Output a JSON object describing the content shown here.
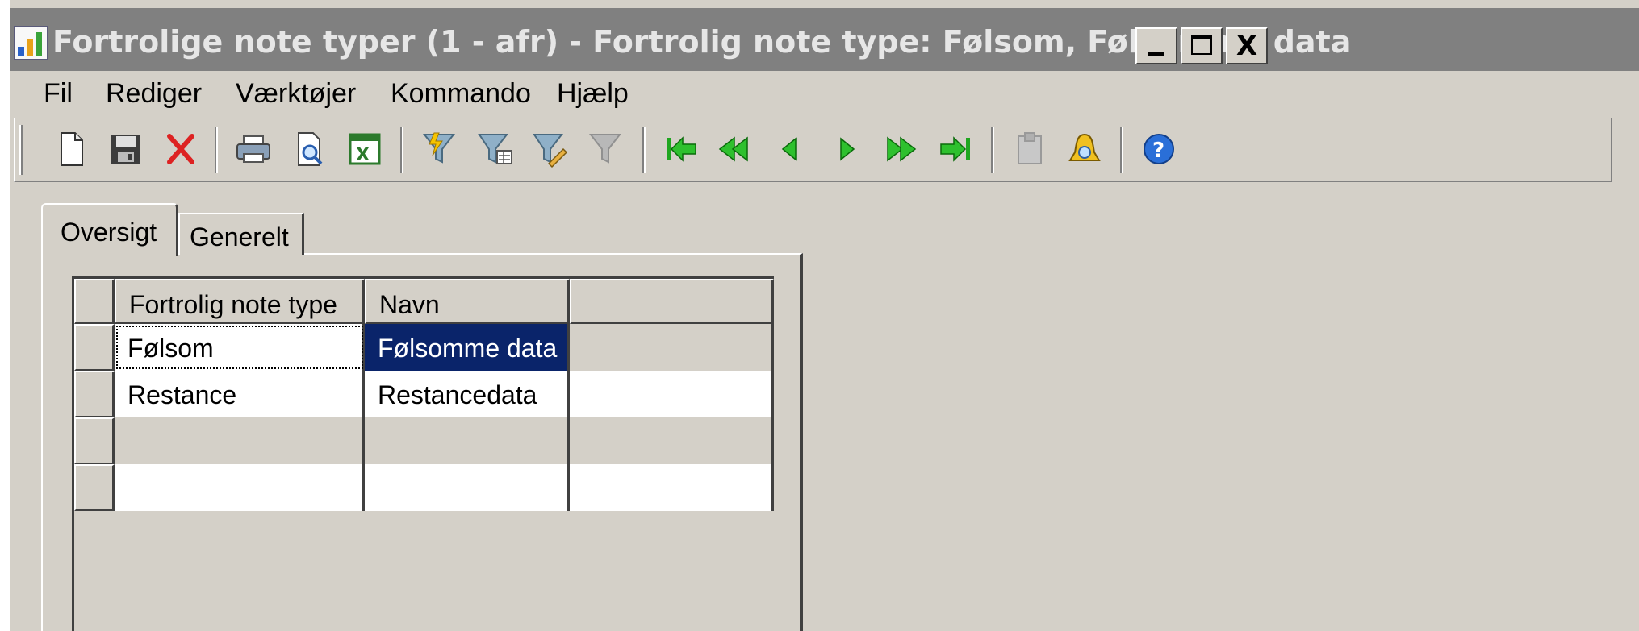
{
  "window": {
    "title": "Fortrolige note typer (1 - afr) - Fortrolig note type: Følsom, Følsomme data",
    "app_icon": "dynamics-ax-chart-icon",
    "controls": {
      "minimize": "",
      "maximize": "",
      "close": "X"
    }
  },
  "menu": [
    {
      "label": "Fil"
    },
    {
      "label": "Rediger"
    },
    {
      "label": "Værktøjer"
    },
    {
      "label": "Kommando"
    },
    {
      "label": "Hjælp"
    }
  ],
  "toolbar": {
    "buttons": [
      {
        "icon": "new-document-icon",
        "enabled": true
      },
      {
        "icon": "save-icon",
        "enabled": true
      },
      {
        "icon": "delete-icon",
        "enabled": true
      },
      {
        "icon": "print-icon",
        "enabled": true
      },
      {
        "icon": "print-preview-icon",
        "enabled": true
      },
      {
        "icon": "export-excel-icon",
        "enabled": true
      },
      {
        "icon": "filter-by-selection-icon",
        "enabled": true
      },
      {
        "icon": "advanced-filter-icon",
        "enabled": true
      },
      {
        "icon": "filter-by-grid-icon",
        "enabled": true
      },
      {
        "icon": "remove-filter-icon",
        "enabled": false
      },
      {
        "icon": "first-record-icon",
        "enabled": true
      },
      {
        "icon": "previous-page-icon",
        "enabled": true
      },
      {
        "icon": "previous-record-icon",
        "enabled": true
      },
      {
        "icon": "next-record-icon",
        "enabled": true
      },
      {
        "icon": "next-page-icon",
        "enabled": true
      },
      {
        "icon": "last-record-icon",
        "enabled": true
      },
      {
        "icon": "document-handling-icon",
        "enabled": false
      },
      {
        "icon": "alert-bell-icon",
        "enabled": true
      },
      {
        "icon": "help-icon",
        "enabled": true
      }
    ]
  },
  "tabs": [
    {
      "label": "Oversigt",
      "active": true
    },
    {
      "label": "Generelt",
      "active": false
    }
  ],
  "grid": {
    "columns": [
      "Fortrolig note type",
      "Navn",
      ""
    ],
    "rows": [
      [
        "Følsom",
        "Følsomme data",
        ""
      ],
      [
        "Restance",
        "Restancedata",
        ""
      ],
      [
        "",
        "",
        ""
      ],
      [
        "",
        "",
        ""
      ]
    ],
    "selected_row": 0
  },
  "colors": {
    "face": "#d4d0c8",
    "titlebar_inactive": "#808080",
    "selection": "#0a246a"
  }
}
